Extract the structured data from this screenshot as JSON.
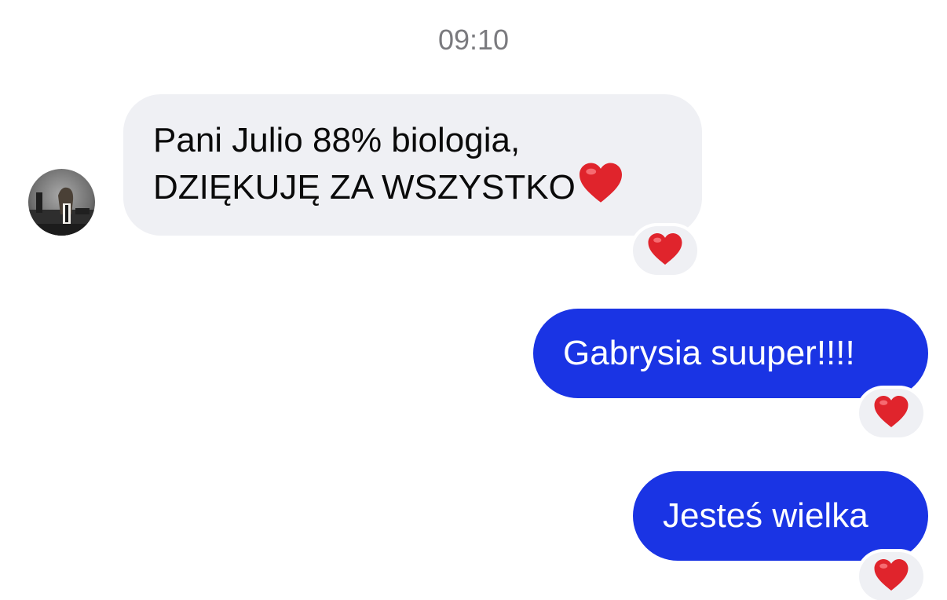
{
  "thread": {
    "timestamp": "09:10"
  },
  "messages": [
    {
      "direction": "incoming",
      "lines": [
        "Pani Julio 88% biologia,",
        "DZIĘKUJĘ ZA WSZYSTKO"
      ],
      "trailing_icon": "red-heart-icon",
      "reaction": "red-heart-icon"
    },
    {
      "direction": "outgoing",
      "text": "Gabrysia suuper!!!!",
      "reaction": "red-heart-icon"
    },
    {
      "direction": "outgoing",
      "text": "Jesteś wielka",
      "reaction": "red-heart-icon"
    }
  ],
  "colors": {
    "incoming_bubble": "#eff0f4",
    "outgoing_bubble": "#1a34e4",
    "timestamp_text": "#7a7a7e",
    "heart": "#e0242c"
  }
}
